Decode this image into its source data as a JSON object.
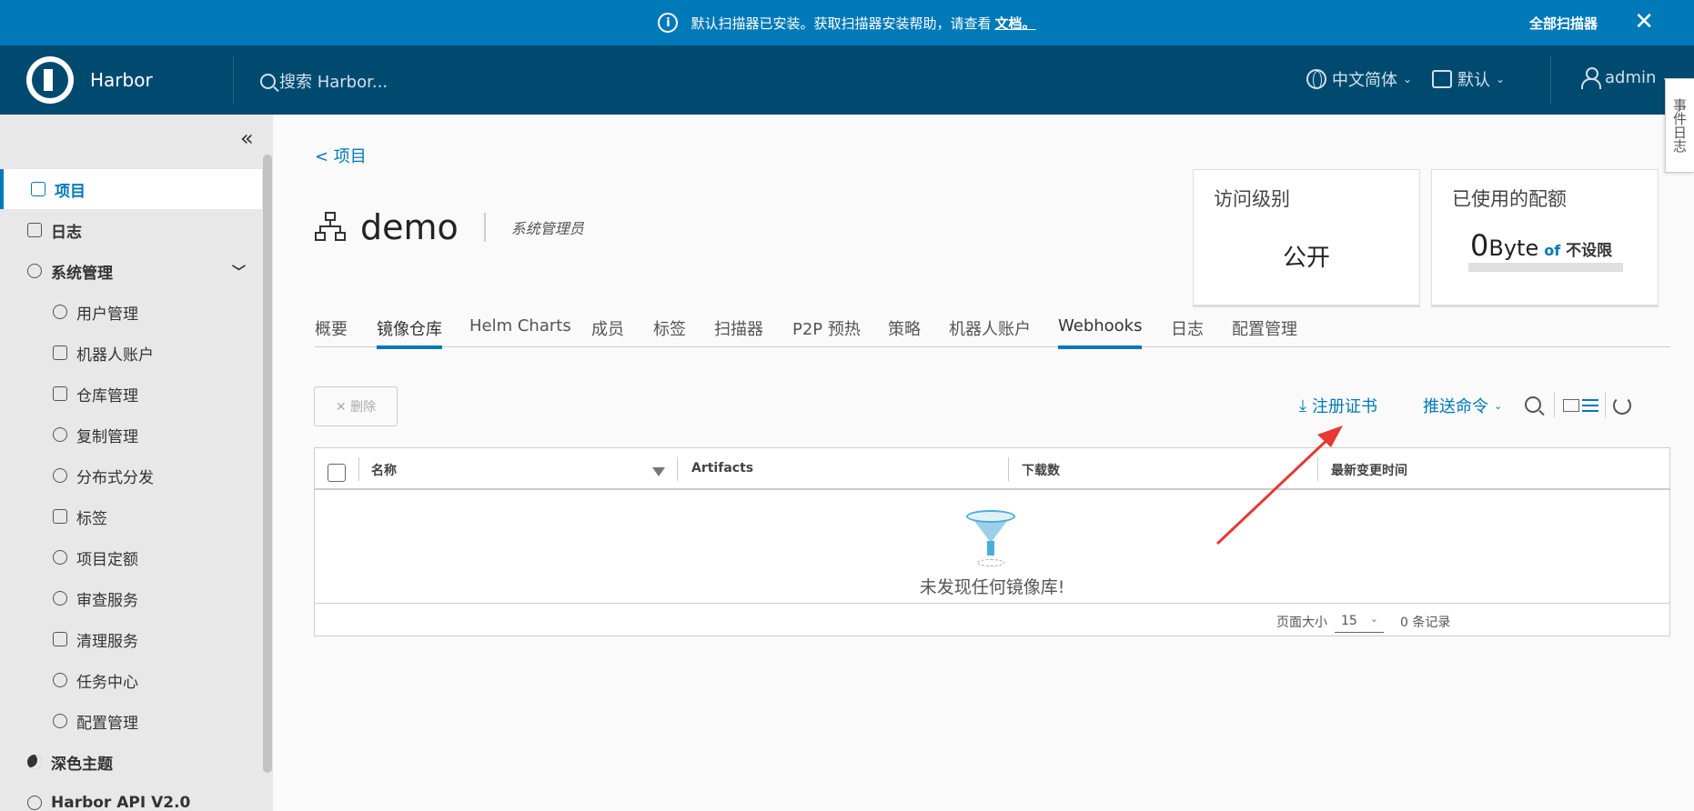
{
  "banner": {
    "message": "默认扫描器已安装。获取扫描器安装帮助，请查看",
    "doc_link": "文档。",
    "all_scanners": "全部扫描器",
    "close_glyph": "✕"
  },
  "header": {
    "brand": "Harbor",
    "search_placeholder": "搜索 Harbor...",
    "language": "中文简体",
    "datetime_format": "默认",
    "user": "admin"
  },
  "event_log_tab": "事件日志",
  "sidebar": {
    "collapse_glyph": "«",
    "items": [
      {
        "label": "项目"
      },
      {
        "label": "日志"
      },
      {
        "label": "系统管理"
      },
      {
        "label": "用户管理"
      },
      {
        "label": "机器人账户"
      },
      {
        "label": "仓库管理"
      },
      {
        "label": "复制管理"
      },
      {
        "label": "分布式分发"
      },
      {
        "label": "标签"
      },
      {
        "label": "项目定额"
      },
      {
        "label": "审查服务"
      },
      {
        "label": "清理服务"
      },
      {
        "label": "任务中心"
      },
      {
        "label": "配置管理"
      },
      {
        "label": "深色主题"
      },
      {
        "label": "Harbor API V2.0"
      }
    ]
  },
  "project": {
    "breadcrumb": "<  项目",
    "name": "demo",
    "role": "系统管理员",
    "access_card": {
      "title": "访问级别",
      "value": "公开"
    },
    "quota_card": {
      "title": "已使用的配额",
      "used_num": "0",
      "used_unit": "Byte",
      "of": "of",
      "limit": "不设限",
      "usage_fraction": 0
    }
  },
  "tabs": [
    {
      "label": "概要"
    },
    {
      "label": "镜像仓库"
    },
    {
      "label": "Helm Charts"
    },
    {
      "label": "成员"
    },
    {
      "label": "标签"
    },
    {
      "label": "扫描器"
    },
    {
      "label": "P2P 预热"
    },
    {
      "label": "策略"
    },
    {
      "label": "机器人账户"
    },
    {
      "label": "Webhooks"
    },
    {
      "label": "日志"
    },
    {
      "label": "配置管理"
    }
  ],
  "toolbar": {
    "delete_label": "✕  删除",
    "register_cert": "注册证书",
    "push_command": "推送命令"
  },
  "table": {
    "columns": [
      "名称",
      "Artifacts",
      "下载数",
      "最新变更时间"
    ],
    "empty_text": "未发现任何镜像库!",
    "page_size_label": "页面大小",
    "page_size": "15",
    "record_count": "0 条记录"
  },
  "colors": {
    "banner": "#0079b8",
    "header": "#004a70",
    "accent": "#0079b8",
    "annotation_arrow": "#e53935"
  }
}
